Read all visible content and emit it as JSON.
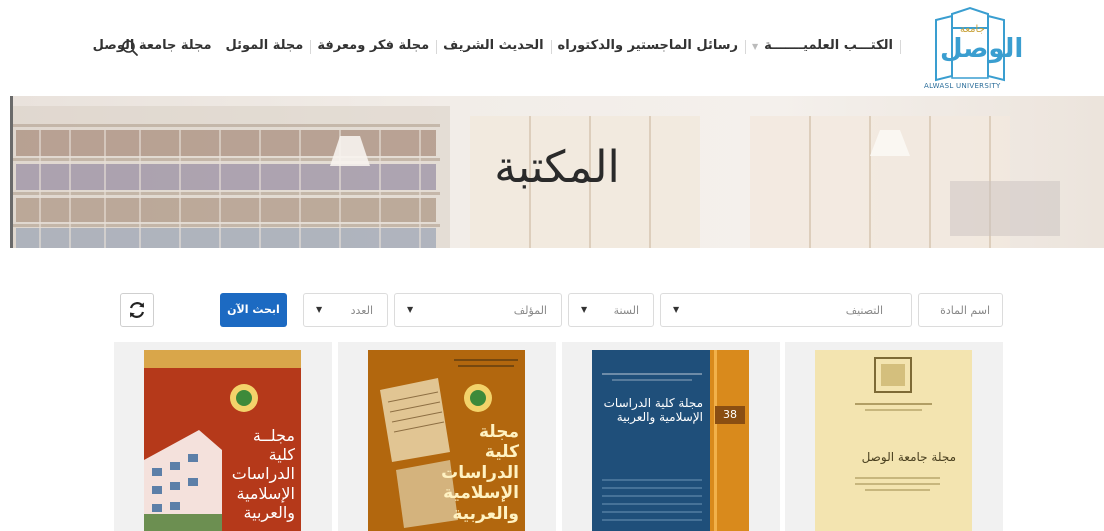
{
  "logo": {
    "arabic": "الوصل",
    "small": "جامعة",
    "english": "ALWASL UNIVERSITY"
  },
  "nav": [
    {
      "label": "مجلة جامعة الوصل"
    },
    {
      "label": "مجلة الموئل"
    },
    {
      "label": "مجلة فكر ومعرفة"
    },
    {
      "label": "الحديث الشريف"
    },
    {
      "label": "رسائل الماجستير والدكتوراه"
    },
    {
      "label": "الكتـــب العلميـــــــة"
    }
  ],
  "search_icon": "search-icon",
  "hero": {
    "title": "المكتبة"
  },
  "filters": {
    "subject_placeholder": "اسم المادة",
    "category_placeholder": "التصنيف",
    "year_placeholder": "السنة",
    "author_placeholder": "المؤلف",
    "issue_placeholder": "العدد",
    "search_button": "ابحث الآن",
    "refresh_icon": "refresh-icon"
  },
  "books": [
    {
      "title": "مجلة جامعة الوصل",
      "subtitle": "جامعة الوصل",
      "color": "#f3e4b0"
    },
    {
      "title": "مجلة كلية الدراسات الإسلامية والعربية",
      "number": "38",
      "color": "#1f4f7a"
    },
    {
      "title": "مجلة كلية الدراسات الإسلامية والعربية",
      "color": "#b2670e"
    },
    {
      "title": "مجلــة كلية الدراسات الإسلامية والعربية",
      "color": "#b5391a"
    }
  ]
}
